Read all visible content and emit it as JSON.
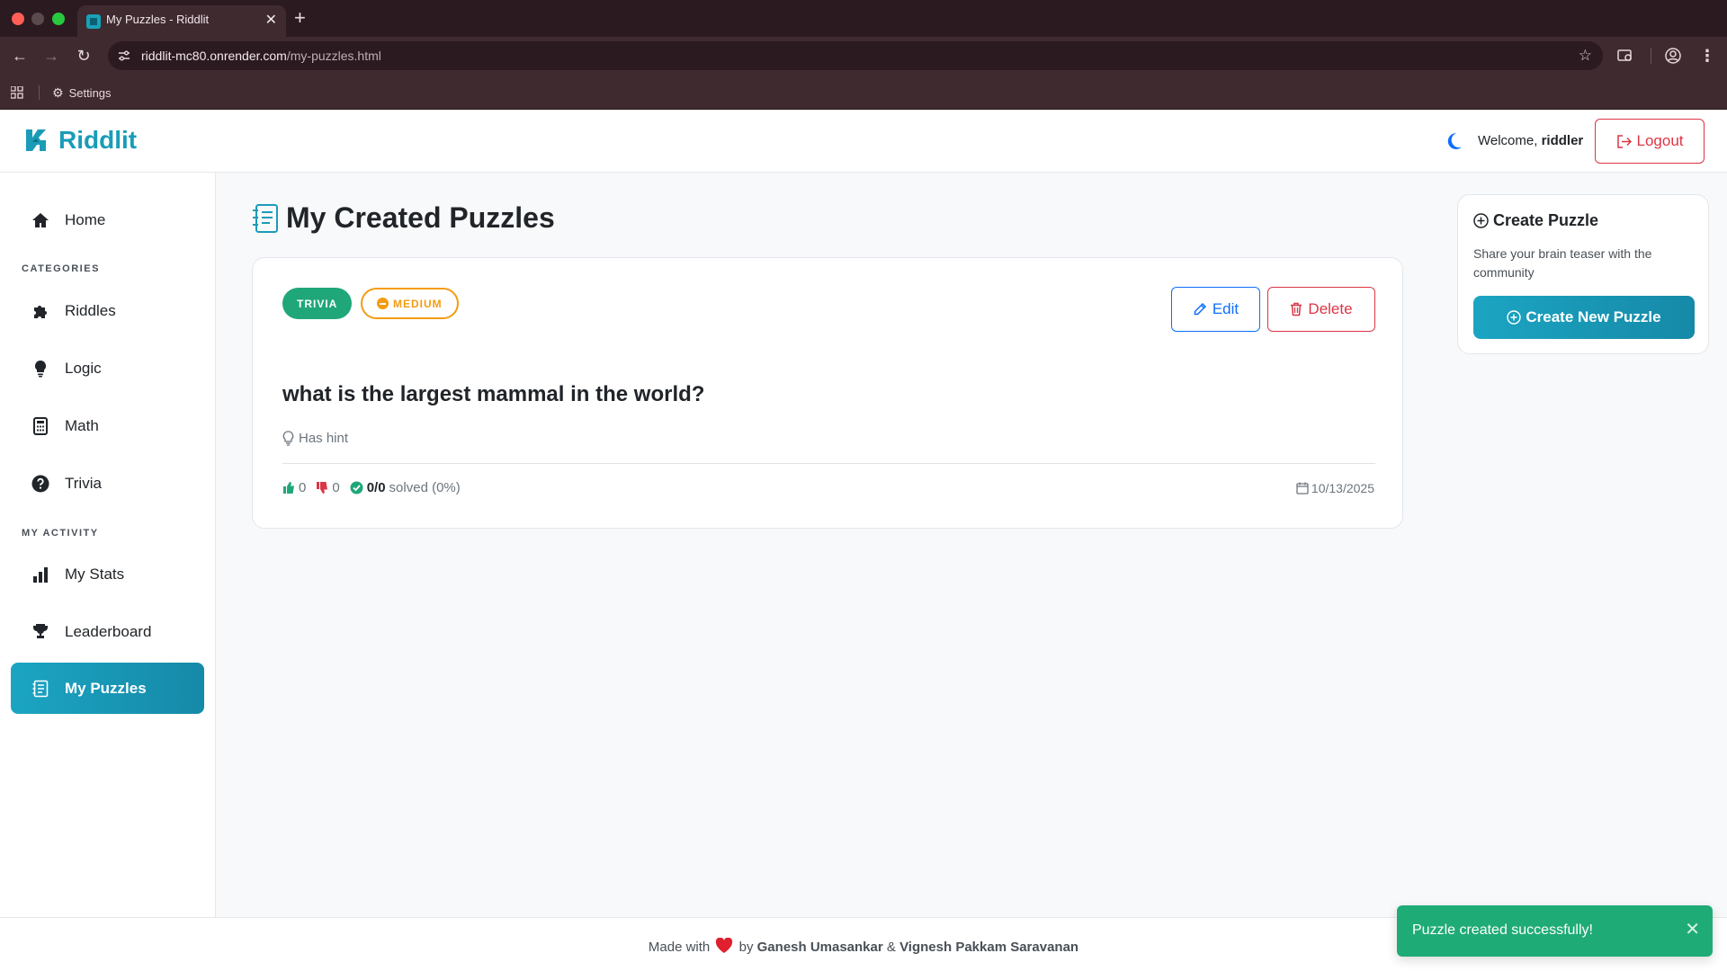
{
  "browser": {
    "tab_title": "My Puzzles - Riddlit",
    "url_domain": "riddlit-mc80.onrender.com",
    "url_path": "/my-puzzles.html",
    "bookmark_settings": "Settings"
  },
  "header": {
    "brand": "Riddlit",
    "welcome_prefix": "Welcome,",
    "username": "riddler",
    "logout_label": "Logout"
  },
  "sidebar": {
    "home": "Home",
    "categories_heading": "CATEGORIES",
    "categories": [
      "Riddles",
      "Logic",
      "Math",
      "Trivia"
    ],
    "activity_heading": "MY ACTIVITY",
    "activity": [
      "My Stats",
      "Leaderboard",
      "My Puzzles"
    ],
    "active_item": "My Puzzles"
  },
  "main": {
    "title": "My Created Puzzles",
    "puzzles": [
      {
        "category": "TRIVIA",
        "difficulty": "MEDIUM",
        "edit_label": "Edit",
        "delete_label": "Delete",
        "question": "what is the largest mammal in the world?",
        "hint_label": "Has hint",
        "likes": "0",
        "dislikes": "0",
        "solved": "0/0",
        "solved_suffix": "solved (0%)",
        "date": "10/13/2025"
      }
    ]
  },
  "create_panel": {
    "title": "Create Puzzle",
    "description": "Share your brain teaser with the community",
    "button_label": "Create New Puzzle"
  },
  "footer": {
    "made_with": "Made with",
    "by": "by",
    "author1": "Ganesh Umasankar",
    "amp": "&",
    "author2": "Vignesh Pakkam Saravanan"
  },
  "toast": {
    "message": "Puzzle created successfully!"
  },
  "colors": {
    "brand": "#1a9cb8",
    "active_gradient_start": "#1ba5c2",
    "danger": "#dc3545",
    "primary": "#0d6efd",
    "success": "#20a779",
    "warning": "#f39c12",
    "toast": "#1fab76"
  },
  "icons": {
    "sidebar": [
      "home-icon",
      "puzzle-icon",
      "lightbulb-icon",
      "calculator-icon",
      "question-circle-icon",
      "bar-chart-icon",
      "trophy-icon",
      "journal-icon"
    ]
  }
}
